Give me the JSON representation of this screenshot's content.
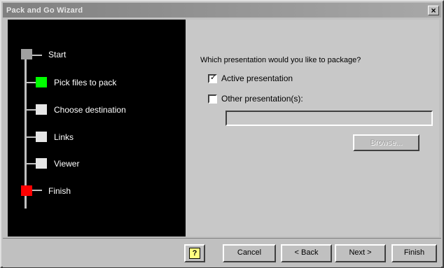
{
  "window": {
    "title": "Pack and Go Wizard",
    "close_label": "×"
  },
  "steps": [
    {
      "label": "Start",
      "color": "#a0a0a0",
      "state": "done"
    },
    {
      "label": "Pick files to pack",
      "color": "#00ff00",
      "state": "current"
    },
    {
      "label": "Choose destination",
      "color": "#e6e6e6",
      "state": "pending"
    },
    {
      "label": "Links",
      "color": "#e6e6e6",
      "state": "pending"
    },
    {
      "label": "Viewer",
      "color": "#e6e6e6",
      "state": "pending"
    },
    {
      "label": "Finish",
      "color": "#ff0000",
      "state": "end"
    }
  ],
  "content": {
    "question": "Which presentation would you like to package?",
    "option_active": {
      "label": "Active presentation",
      "checked": true,
      "checkmark": "✓"
    },
    "option_other": {
      "label": "Other presentation(s):",
      "checked": false,
      "checkmark": ""
    },
    "path_value": "",
    "browse_label": "Browse..."
  },
  "buttons": {
    "help_glyph": "?",
    "cancel": "Cancel",
    "back": "< Back",
    "next": "Next >",
    "finish": "Finish"
  }
}
